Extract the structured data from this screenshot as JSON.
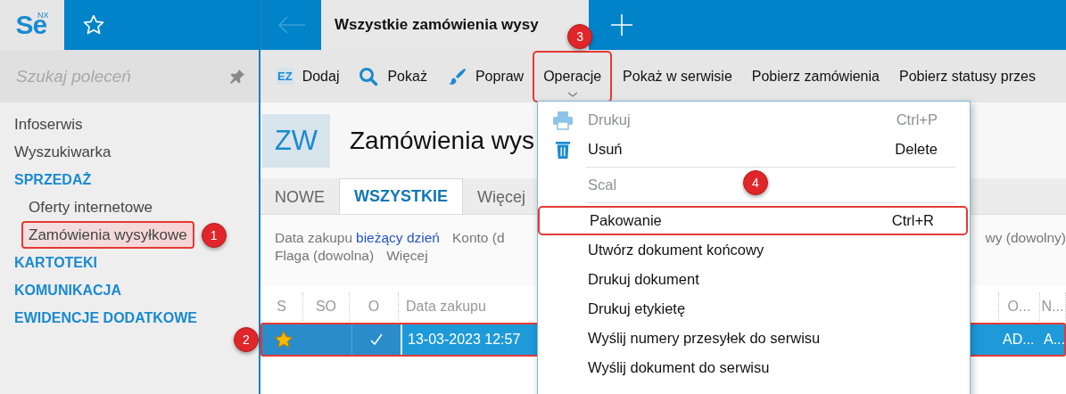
{
  "logo": {
    "text": "Se",
    "superscript": "NX"
  },
  "top_tab": {
    "title": "Wszystkie zamówienia wysy"
  },
  "sidebar": {
    "search": {
      "placeholder": "Szukaj poleceń"
    },
    "items": [
      {
        "label": "Infoserwis",
        "kind": "link",
        "selected": false
      },
      {
        "label": "Wyszukiwarka",
        "kind": "link",
        "selected": false
      },
      {
        "label": "SPRZEDAŻ",
        "kind": "section",
        "selected": false,
        "children": [
          {
            "label": "Oferty internetowe",
            "kind": "link",
            "selected": false
          },
          {
            "label": "Zamówienia wysyłkowe",
            "kind": "link",
            "selected": true,
            "callout": "1"
          }
        ]
      },
      {
        "label": "KARTOTEKI",
        "kind": "section",
        "selected": false
      },
      {
        "label": "KOMUNIKACJA",
        "kind": "section",
        "selected": false
      },
      {
        "label": "EWIDENCJE DODATKOWE",
        "kind": "section",
        "selected": false
      }
    ]
  },
  "toolbar": [
    {
      "label": "Dodaj",
      "kind": "ez",
      "icon_text": "EZ"
    },
    {
      "label": "Pokaż",
      "kind": "search"
    },
    {
      "label": "Popraw",
      "kind": "brush"
    },
    {
      "label": "Operacje",
      "kind": "text",
      "dropdown": true,
      "callout": "3"
    },
    {
      "label": "Pokaż w serwisie",
      "kind": "text"
    },
    {
      "label": "Pobierz zamówienia",
      "kind": "text"
    },
    {
      "label": "Pobierz statusy przes",
      "kind": "text"
    }
  ],
  "header": {
    "badge": "ZW",
    "title": "Zamówienia wys"
  },
  "tabs": [
    {
      "label": "NOWE",
      "selected": false
    },
    {
      "label": "WSZYSTKIE",
      "selected": true
    },
    {
      "label": "Więcej",
      "selected": false
    }
  ],
  "filters": [
    [
      {
        "label": "Data zakupu",
        "value": "bieżący dzień"
      },
      {
        "label": "Konto (d"
      },
      {
        "label": "wy (dowolny)"
      }
    ],
    [
      {
        "label": "Flaga (dowolna)"
      },
      {
        "label": "Więcej"
      }
    ]
  ],
  "table": {
    "columns": [
      "S",
      "SO",
      "O",
      "Data zakupu",
      "O...",
      "N..."
    ],
    "rows": [
      {
        "selected": true,
        "favorite": true,
        "confirmed": true,
        "date": "13-03-2023 12:57",
        "column_o": "AD...",
        "column_n": "A...",
        "callout": "2"
      }
    ]
  },
  "menu": {
    "items": [
      {
        "label": "Drukuj",
        "shortcut": "Ctrl+P",
        "kind": "printer",
        "disabled": true,
        "outlined": false
      },
      {
        "label": "Usuń",
        "shortcut": "Delete",
        "kind": "trash",
        "disabled": false,
        "outlined": false,
        "separator_after": true
      },
      {
        "label": "Scal",
        "kind": "text",
        "disabled": true,
        "outlined": false,
        "separator_after": true,
        "callout": "4"
      },
      {
        "label": "Pakowanie",
        "shortcut": "Ctrl+R",
        "kind": "text",
        "disabled": false,
        "outlined": true
      },
      {
        "label": "Utwórz dokument końcowy",
        "kind": "text",
        "disabled": false,
        "outlined": false
      },
      {
        "label": "Drukuj dokument",
        "kind": "text",
        "disabled": false,
        "outlined": false
      },
      {
        "label": "Drukuj etykietę",
        "kind": "text",
        "disabled": false,
        "outlined": false
      },
      {
        "label": "Wyślij numery przesyłek do serwisu",
        "kind": "text",
        "disabled": false,
        "outlined": false
      },
      {
        "label": "Wyślij dokument do serwisu",
        "kind": "text",
        "disabled": false,
        "outlined": false
      }
    ]
  }
}
